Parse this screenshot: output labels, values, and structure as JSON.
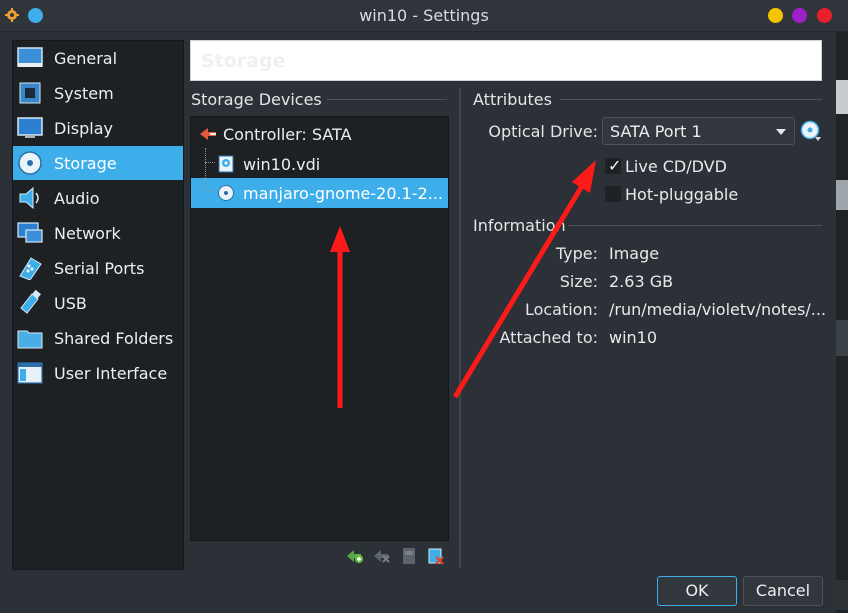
{
  "window": {
    "title": "win10 - Settings"
  },
  "colors": {
    "accent": "#3daee9",
    "annotation": "#ff1a1a",
    "dot_yellow": "#f5c400",
    "dot_purple": "#a020c8",
    "dot_red": "#e8202a"
  },
  "sidebar": {
    "items": [
      {
        "label": "General",
        "icon": "general-icon"
      },
      {
        "label": "System",
        "icon": "system-icon"
      },
      {
        "label": "Display",
        "icon": "display-icon"
      },
      {
        "label": "Storage",
        "icon": "storage-icon",
        "active": true
      },
      {
        "label": "Audio",
        "icon": "audio-icon"
      },
      {
        "label": "Network",
        "icon": "network-icon"
      },
      {
        "label": "Serial Ports",
        "icon": "serial-ports-icon"
      },
      {
        "label": "USB",
        "icon": "usb-icon"
      },
      {
        "label": "Shared Folders",
        "icon": "shared-folders-icon"
      },
      {
        "label": "User Interface",
        "icon": "user-interface-icon"
      }
    ]
  },
  "header": {
    "title": "Storage"
  },
  "storage_devices": {
    "caption": "Storage Devices",
    "controller": "Controller: SATA",
    "items": [
      {
        "label": "win10.vdi",
        "icon": "hard-disk-icon"
      },
      {
        "label": "manjaro-gnome-20.1-2...",
        "icon": "optical-disc-icon",
        "selected": true
      }
    ]
  },
  "attributes": {
    "caption": "Attributes",
    "optical_drive_label": "Optical Drive:",
    "optical_drive_value": "SATA Port 1",
    "live_cd_label": "Live CD/DVD",
    "live_cd_checked": true,
    "hot_pluggable_label": "Hot-pluggable",
    "hot_pluggable_checked": false
  },
  "information": {
    "caption": "Information",
    "rows": [
      {
        "label": "Type:",
        "value": "Image"
      },
      {
        "label": "Size:",
        "value": "2.63 GB"
      },
      {
        "label": "Location:",
        "value": "/run/media/violetv/notes/..."
      },
      {
        "label": "Attached to:",
        "value": "win10"
      }
    ]
  },
  "buttons": {
    "ok": "OK",
    "cancel": "Cancel"
  }
}
